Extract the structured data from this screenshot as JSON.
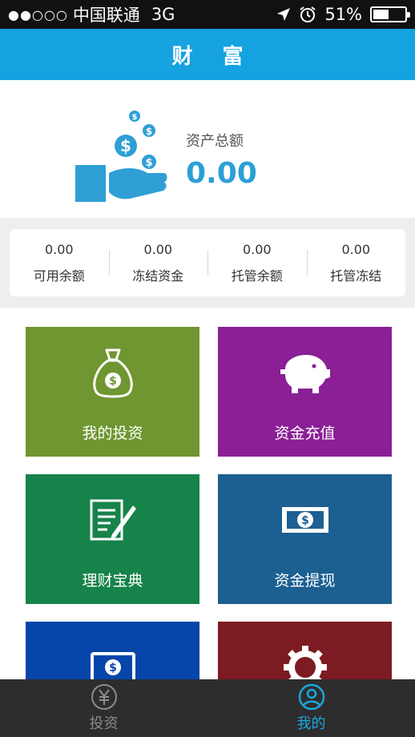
{
  "status_bar": {
    "signal": "●●○○○",
    "carrier": "中国联通",
    "network": "3G",
    "battery_percent": "51%",
    "battery_level": 0.51,
    "icons": [
      "location-arrow-icon",
      "alarm-clock-icon",
      "battery-icon"
    ]
  },
  "header": {
    "title": "财 富"
  },
  "assets": {
    "label": "资产总额",
    "value": "0.00",
    "accent": "#2c9fd8"
  },
  "summary": [
    {
      "value": "0.00",
      "label": "可用余额"
    },
    {
      "value": "0.00",
      "label": "冻结资金"
    },
    {
      "value": "0.00",
      "label": "托管余额"
    },
    {
      "value": "0.00",
      "label": "托管冻结"
    }
  ],
  "tiles": [
    {
      "label": "我的投资",
      "icon": "money-bag-icon",
      "color": "#6f9630"
    },
    {
      "label": "资金充值",
      "icon": "piggy-bank-icon",
      "color": "#8a1f96"
    },
    {
      "label": "理财宝典",
      "icon": "document-pen-icon",
      "color": "#16834a"
    },
    {
      "label": "资金提现",
      "icon": "banknote-icon",
      "color": "#1c5f91"
    },
    {
      "label": "",
      "icon": "monitor-dollar-icon",
      "color": "#0645aa"
    },
    {
      "label": "",
      "icon": "settings-gear-icon",
      "color": "#7c1b21"
    }
  ],
  "tabbar": {
    "items": [
      {
        "label": "投资",
        "icon": "yen-coin-icon",
        "active": false
      },
      {
        "label": "我的",
        "icon": "user-profile-icon",
        "active": true
      }
    ],
    "active_color": "#1ba7de",
    "inactive_color": "#8c8c8c"
  }
}
